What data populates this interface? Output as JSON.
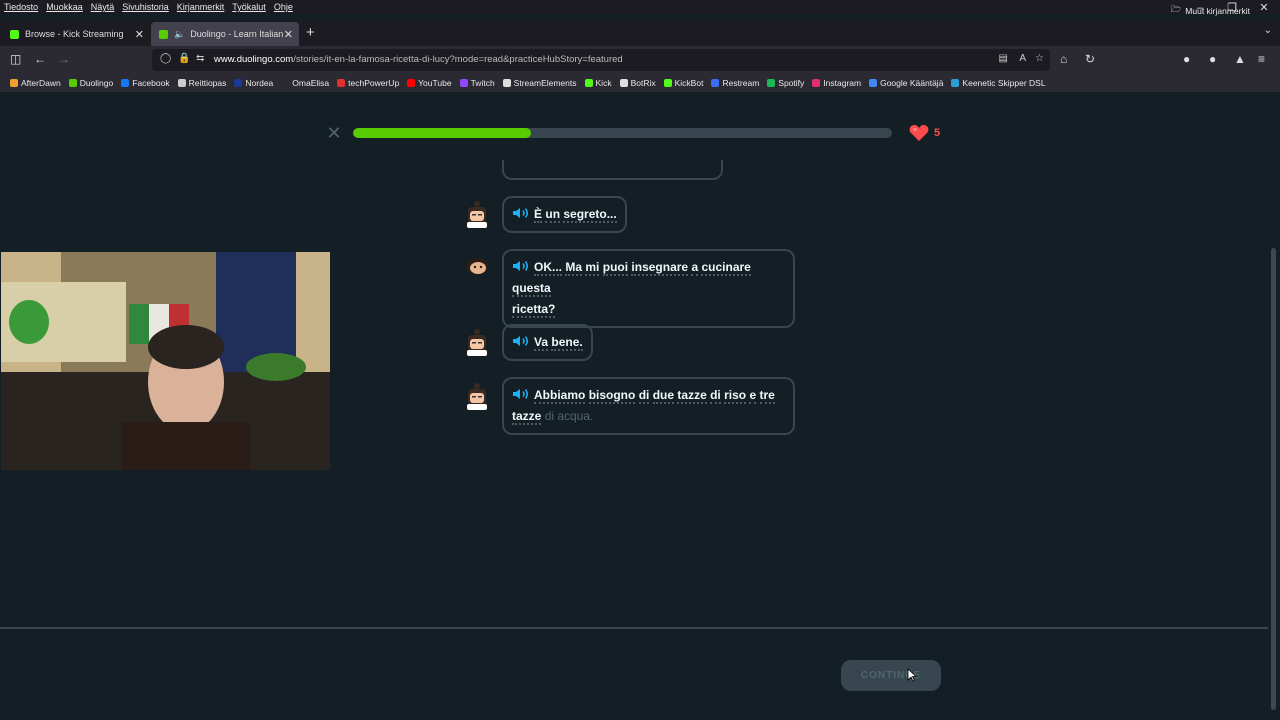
{
  "menubar": {
    "items": [
      "Tiedosto",
      "Muokkaa",
      "Näytä",
      "Sivuhistoria",
      "Kirjanmerkit",
      "Työkalut",
      "Ohje"
    ]
  },
  "tabs": [
    {
      "label": "Browse - Kick Streaming",
      "icon": "kick-favicon",
      "color": "#53fc18"
    },
    {
      "label": "Duolingo - Learn Italian wit",
      "icon": "duolingo-favicon",
      "color": "#58cc02"
    }
  ],
  "address": {
    "domain": "www.duolingo.com",
    "path": "/stories/it-en-la-famosa-ricetta-di-lucy?mode=read&practiceHubStory=featured"
  },
  "bookmarks": [
    {
      "label": "AfterDawn",
      "color": "#f0a030"
    },
    {
      "label": "Duolingo",
      "color": "#58cc02"
    },
    {
      "label": "Facebook",
      "color": "#1877f2"
    },
    {
      "label": "Reittiopas",
      "color": "#cccccc"
    },
    {
      "label": "Nordea",
      "color": "#1a3a9a"
    },
    {
      "label": "OmaElisa",
      "color": "#2b2a33"
    },
    {
      "label": "techPowerUp",
      "color": "#e03030"
    },
    {
      "label": "YouTube",
      "color": "#ff0000"
    },
    {
      "label": "Twitch",
      "color": "#9146ff"
    },
    {
      "label": "StreamElements",
      "color": "#dddddd"
    },
    {
      "label": "Kick",
      "color": "#53fc18"
    },
    {
      "label": "BotRix",
      "color": "#dddddd"
    },
    {
      "label": "KickBot",
      "color": "#53fc18"
    },
    {
      "label": "Restream",
      "color": "#3a6cf4"
    },
    {
      "label": "Spotify",
      "color": "#1db954"
    },
    {
      "label": "Instagram",
      "color": "#e1306c"
    },
    {
      "label": "Google Kääntäjä",
      "color": "#4285f4"
    },
    {
      "label": "Keenetic Skipper DSL",
      "color": "#2a9fd6"
    }
  ],
  "other_bookmarks": "Muut kirjanmerkit",
  "lesson": {
    "progress_fraction": 0.33,
    "hearts": "5",
    "continue_label": "CONTINUE"
  },
  "dialogue": [
    {
      "speaker": "lucy",
      "words": [
        "È",
        "un",
        "segreto..."
      ]
    },
    {
      "speaker": "zari",
      "line1": [
        "OK...",
        "Ma",
        "mi",
        "puoi",
        "insegnare",
        "a",
        "cucinare",
        "questa"
      ],
      "line2": [
        "ricetta?"
      ]
    },
    {
      "speaker": "lucy",
      "words": [
        "Va",
        "bene."
      ]
    },
    {
      "speaker": "lucy",
      "line1": [
        "Abbiamo",
        "bisogno",
        "di",
        "due",
        "tazze",
        "di",
        "riso",
        "e",
        "tre"
      ],
      "line2": [
        "tazze"
      ],
      "pending": "di acqua."
    }
  ],
  "colors": {
    "accent": "#58cc02",
    "bg": "#131f24",
    "border": "#37464f",
    "speaker": "#1cb0f6",
    "heart": "#ff4b4b"
  }
}
